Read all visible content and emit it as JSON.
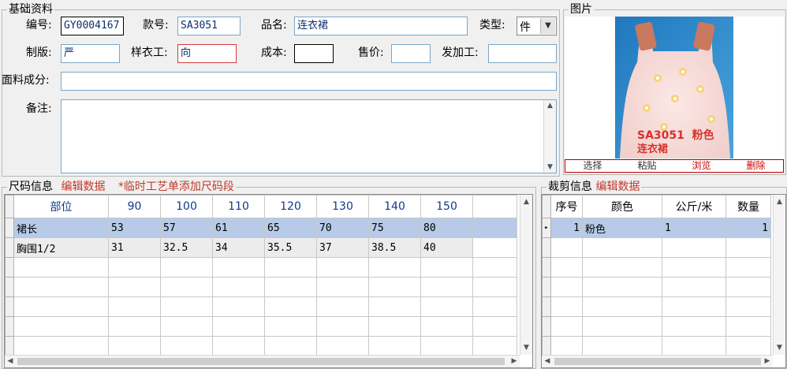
{
  "basic": {
    "legend": "基础资料",
    "code_label": "编号:",
    "code_value": "GY0004167",
    "style_label": "款号:",
    "style_value": "SA3051",
    "name_label": "品名:",
    "name_value": "连衣裙",
    "type_label": "类型:",
    "type_value": "件",
    "pattern_label": "制版:",
    "pattern_value": "严",
    "sample_label": "样衣工:",
    "sample_value": "向",
    "cost_label": "成本:",
    "cost_value": "",
    "price_label": "售价:",
    "price_value": "",
    "process_label": "发加工:",
    "process_value": "",
    "fabric_label": "面料成分:",
    "fabric_value": "",
    "remark_label": "备注:",
    "remark_value": ""
  },
  "image_panel": {
    "legend": "图片",
    "overlay_line1": "SA3051  粉色",
    "overlay_line2": "连衣裙",
    "buttons": [
      "选择",
      "粘贴",
      "浏览",
      "删除"
    ]
  },
  "size_info": {
    "legend": "尺码信息",
    "edit_link": "编辑数据",
    "hint": "*临时工艺单添加尺码段",
    "columns": [
      "部位",
      "90",
      "100",
      "110",
      "120",
      "130",
      "140",
      "150"
    ],
    "rows": [
      [
        "裙长",
        "53",
        "57",
        "61",
        "65",
        "70",
        "75",
        "80"
      ],
      [
        "胸围1/2",
        "31",
        "32.5",
        "34",
        "35.5",
        "37",
        "38.5",
        "40"
      ]
    ]
  },
  "cut_info": {
    "legend": "裁剪信息",
    "edit_link": "编辑数据",
    "columns": [
      "序号",
      "颜色",
      "公斤/米",
      "数量"
    ],
    "rows": [
      [
        "1",
        "粉色",
        "1",
        "1"
      ]
    ],
    "current_row_marker": "▸"
  },
  "colors": {
    "red_accent": "#c0392b",
    "selected_row": "#b7cbe9",
    "header_text": "#123a8c"
  }
}
